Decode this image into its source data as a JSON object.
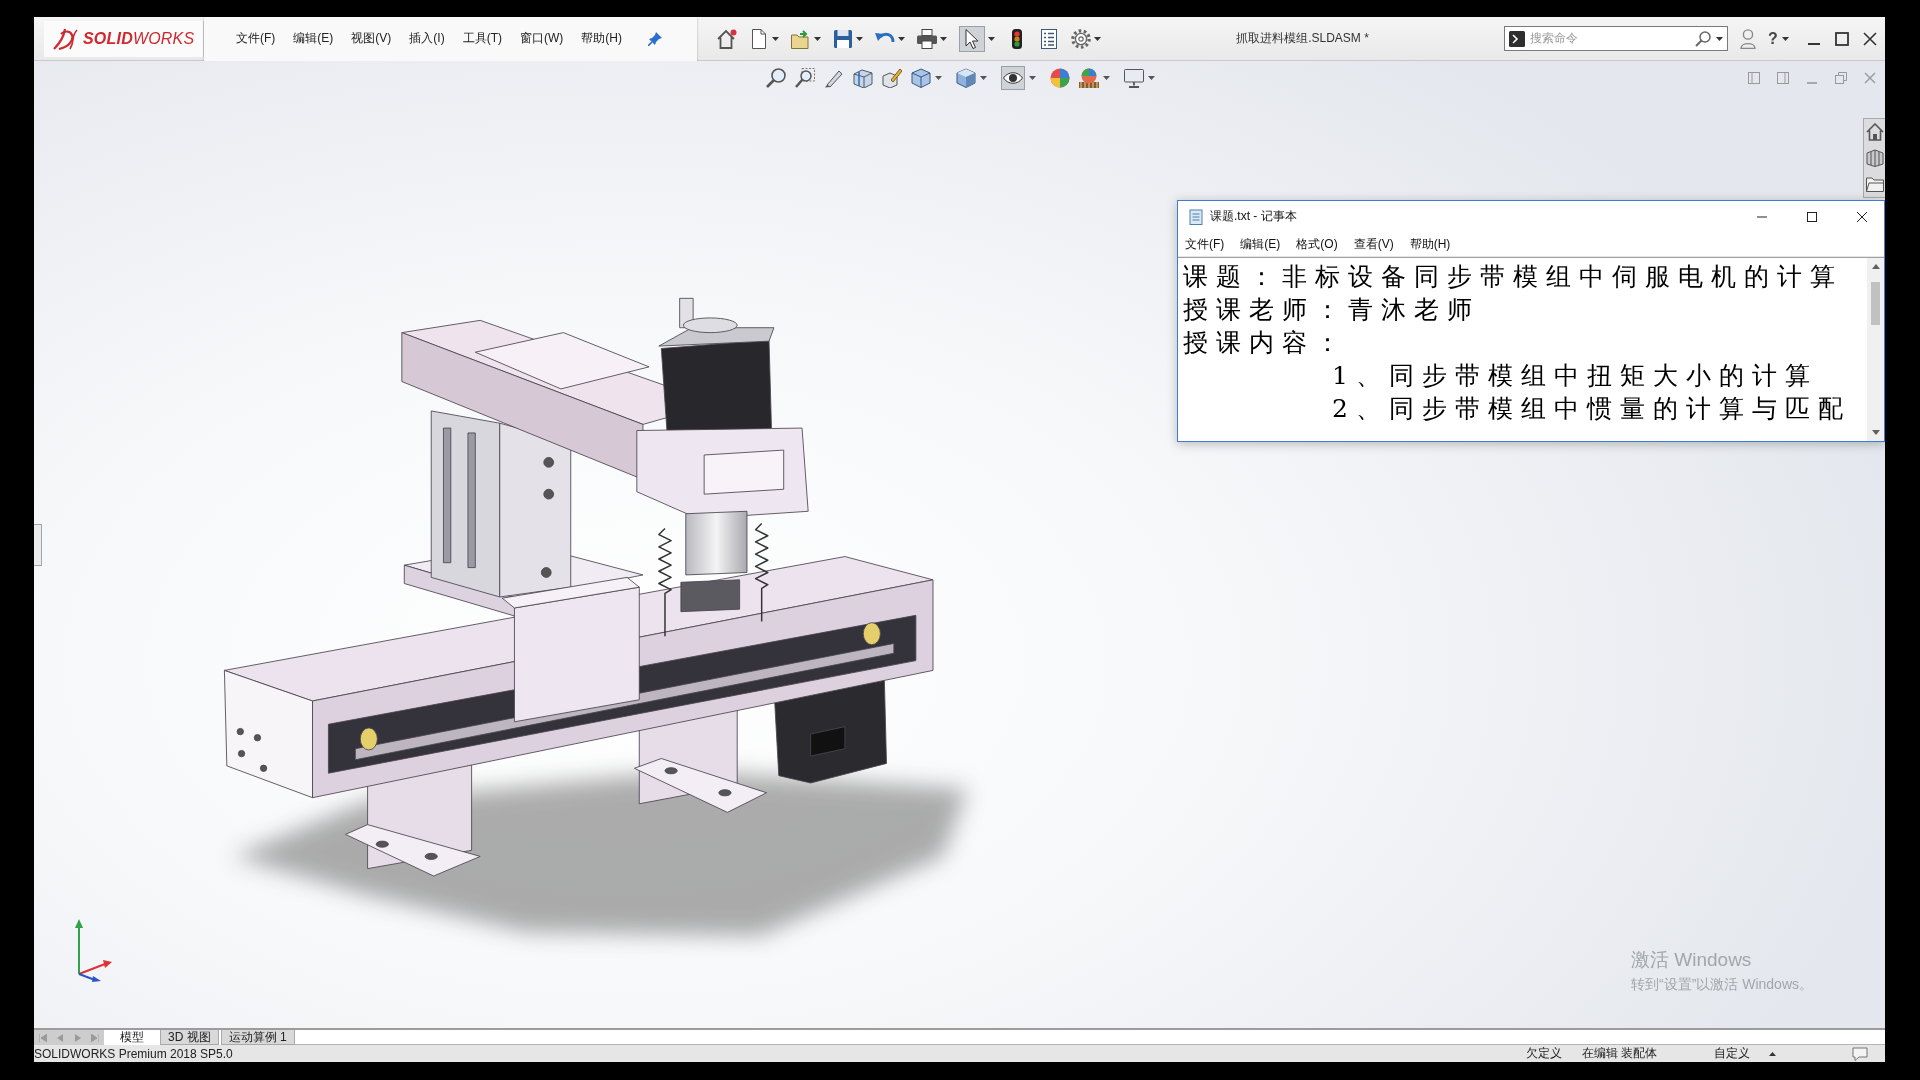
{
  "logo": {
    "text": "**SOLID**WORKS"
  },
  "menu": [
    "文件(F)",
    "编辑(E)",
    "视图(V)",
    "插入(I)",
    "工具(T)",
    "窗口(W)",
    "帮助(H)"
  ],
  "select_tool": {
    "pressed": true
  },
  "document_title": "抓取进料模组.SLDASM *",
  "search": {
    "placeholder": "搜索命令"
  },
  "help_label": "?",
  "hide_show_tool": {
    "pressed": true
  },
  "notepad": {
    "title": "课题.txt - 记事本",
    "menu": [
      "文件(F)",
      "编辑(E)",
      "格式(O)",
      "查看(V)",
      "帮助(H)"
    ],
    "lines": [
      {
        "kind": "heading",
        "text": "课题：非标设备同步带模组中伺服电机的计算"
      },
      {
        "kind": "heading",
        "text": "授课老师：青沐老师"
      },
      {
        "kind": "heading",
        "text": "授课内容："
      },
      {
        "kind": "item",
        "text": "1、同步带模组中扭矩大小的计算"
      },
      {
        "kind": "item",
        "text": "2、同步带模组中惯量的计算与匹配"
      }
    ]
  },
  "activation_notice": {
    "title": "激活 Windows",
    "message": "转到“设置”以激活 Windows。"
  },
  "feature_tabs": [
    {
      "label": "模型",
      "selected": true
    },
    {
      "label": "3D 视图",
      "selected": false
    },
    {
      "label": "运动算例 1",
      "selected": false
    }
  ],
  "status_bar": {
    "product": "SOLIDWORKS Premium 2018 SP5.0",
    "items": [
      "欠定义",
      "在编辑 装配体",
      "自定义"
    ]
  }
}
